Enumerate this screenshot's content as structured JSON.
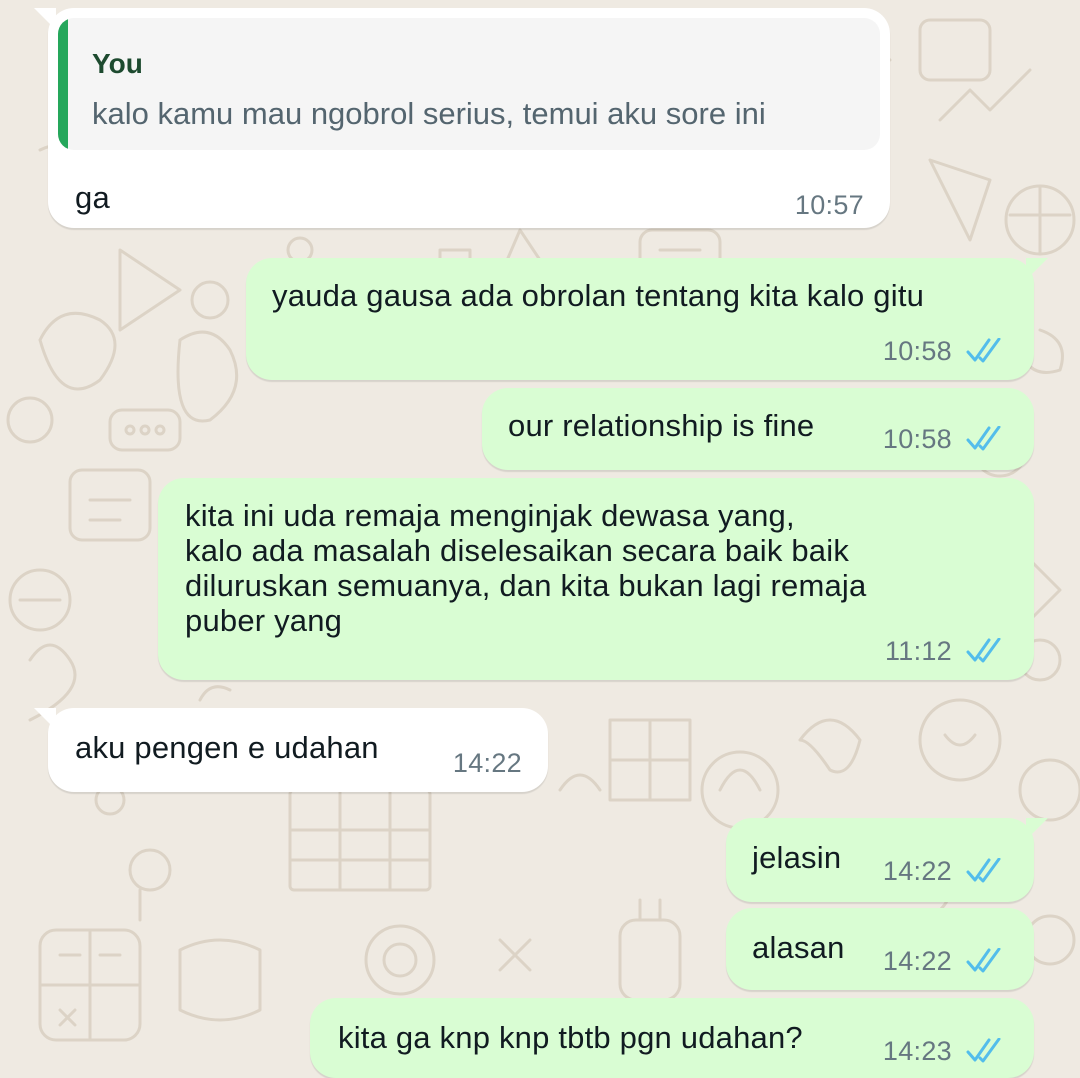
{
  "colors": {
    "wallpaper": "#efeae2",
    "incoming_bubble": "#ffffff",
    "outgoing_bubble": "#d9fdd3",
    "quote_bar": "#25a75b",
    "read_ticks": "#53bdeb"
  },
  "messages": [
    {
      "direction": "incoming",
      "quote": {
        "author": "You",
        "text": "kalo kamu mau ngobrol serius, temui aku sore ini"
      },
      "text": "ga",
      "time": "10:57"
    },
    {
      "direction": "outgoing",
      "text": "yauda gausa ada obrolan tentang kita kalo gitu",
      "time": "10:58",
      "status_icon": "double-check-read-icon"
    },
    {
      "direction": "outgoing",
      "text": "our relationship is fine",
      "time": "10:58",
      "status_icon": "double-check-read-icon"
    },
    {
      "direction": "outgoing",
      "text": "kita ini uda remaja menginjak dewasa yang,\nkalo ada masalah diselesaikan secara baik baik\ndiluruskan semuanya, dan kita bukan lagi remaja\npuber yang",
      "time": "11:12",
      "status_icon": "double-check-read-icon"
    },
    {
      "direction": "incoming",
      "text": "aku pengen e udahan",
      "time": "14:22"
    },
    {
      "direction": "outgoing",
      "text": "jelasin",
      "time": "14:22",
      "status_icon": "double-check-read-icon"
    },
    {
      "direction": "outgoing",
      "text": "alasan",
      "time": "14:22",
      "status_icon": "double-check-read-icon"
    },
    {
      "direction": "outgoing",
      "text": "kita ga knp knp tbtb pgn udahan?",
      "time": "14:23",
      "status_icon": "double-check-read-icon"
    }
  ]
}
